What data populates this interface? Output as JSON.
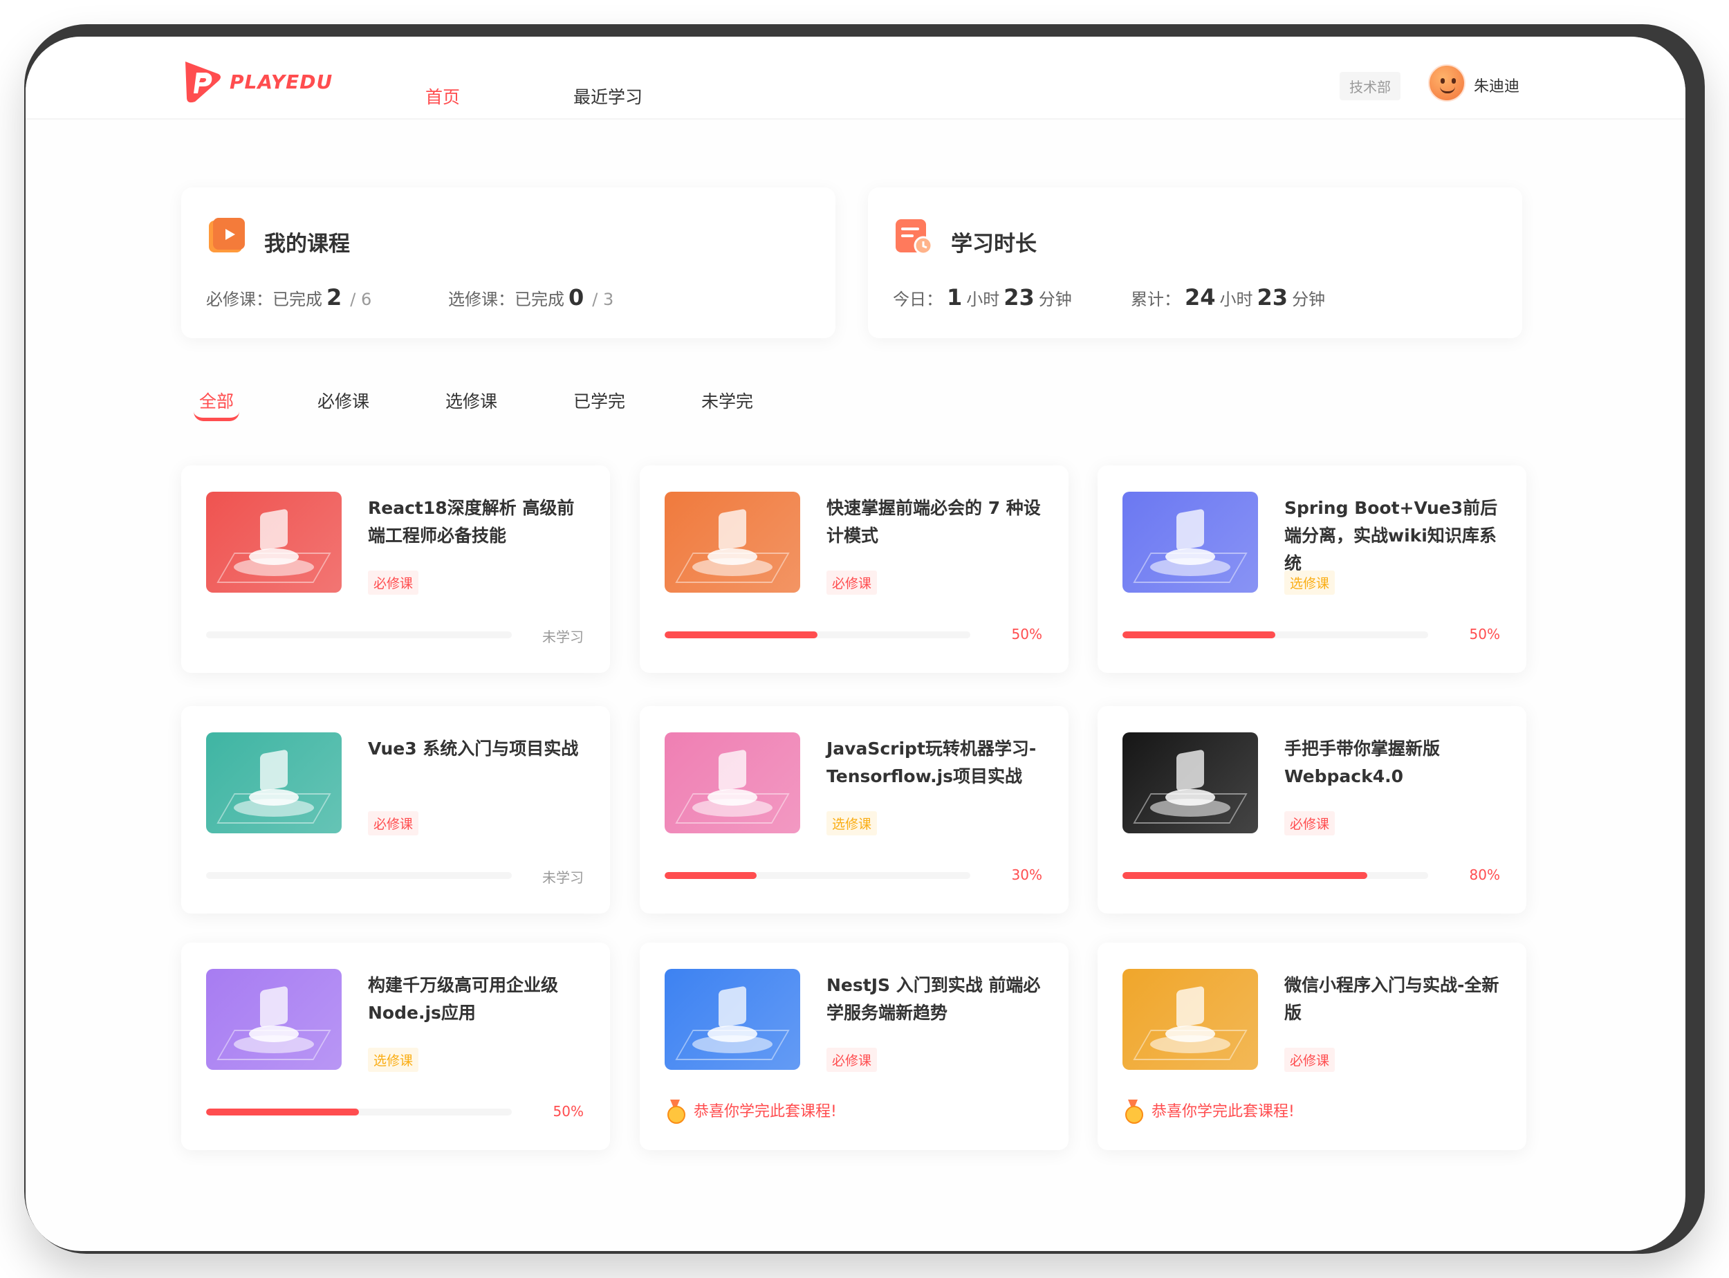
{
  "header": {
    "logo_text": "PLAYEDU",
    "nav": [
      {
        "label": "首页",
        "active": true
      },
      {
        "label": "最近学习",
        "active": false
      }
    ],
    "department": "技术部",
    "user_name": "朱迪迪"
  },
  "stats": {
    "courses": {
      "title": "我的课程",
      "required_label": "必修课：已完成",
      "required_done": "2",
      "required_total": "/ 6",
      "elective_label": "选修课：已完成",
      "elective_done": "0",
      "elective_total": "/ 3"
    },
    "duration": {
      "title": "学习时长",
      "today_label": "今日：",
      "today_hours": "1",
      "today_minutes": "23",
      "total_label": "累计：",
      "total_hours": "24",
      "total_minutes": "23",
      "hour_unit": "小时",
      "minute_unit": "分钟"
    }
  },
  "tabs": [
    {
      "label": "全部",
      "active": true
    },
    {
      "label": "必修课",
      "active": false
    },
    {
      "label": "选修课",
      "active": false
    },
    {
      "label": "已学完",
      "active": false
    },
    {
      "label": "未学完",
      "active": false
    }
  ],
  "courses": [
    {
      "title": "React18深度解析 高级前端工程师必备技能",
      "type": "必修课",
      "kind": "req",
      "progress": 0,
      "status": "未学习",
      "color": "#ef5350"
    },
    {
      "title": "快速掌握前端必会的 7 种设计模式",
      "type": "必修课",
      "kind": "req",
      "progress": 0.5,
      "status": "50%",
      "color": "#f07a3d"
    },
    {
      "title": "Spring Boot+Vue3前后端分离，实战wiki知识库系统",
      "type": "选修课",
      "kind": "ele",
      "progress": 0.5,
      "status": "50%",
      "color": "#6b78f2"
    },
    {
      "title": "Vue3 系统入门与项目实战",
      "type": "必修课",
      "kind": "req",
      "progress": 0,
      "status": "未学习",
      "color": "#3fb5a3"
    },
    {
      "title": "JavaScript玩转机器学习-Tensorflow.js项目实战",
      "type": "选修课",
      "kind": "ele",
      "progress": 0.3,
      "status": "30%",
      "color": "#ef7fb3"
    },
    {
      "title": "手把手带你掌握新版Webpack4.0",
      "type": "必修课",
      "kind": "req",
      "progress": 0.8,
      "status": "80%",
      "color": "#161616"
    },
    {
      "title": "构建千万级高可用企业级Node.js应用",
      "type": "选修课",
      "kind": "ele",
      "progress": 0.5,
      "status": "50%",
      "color": "#a77cf2"
    },
    {
      "title": "NestJS 入门到实战 前端必学服务端新趋势",
      "type": "必修课",
      "kind": "req",
      "progress": 1,
      "status": "恭喜你学完此套课程!",
      "color": "#3d82f2"
    },
    {
      "title": "微信小程序入门与实战-全新版",
      "type": "必修课",
      "kind": "req",
      "progress": 1,
      "status": "恭喜你学完此套课程!",
      "color": "#f0a62b"
    }
  ],
  "colors": {
    "accent": "#ff4d4f",
    "elective": "#faad14"
  }
}
